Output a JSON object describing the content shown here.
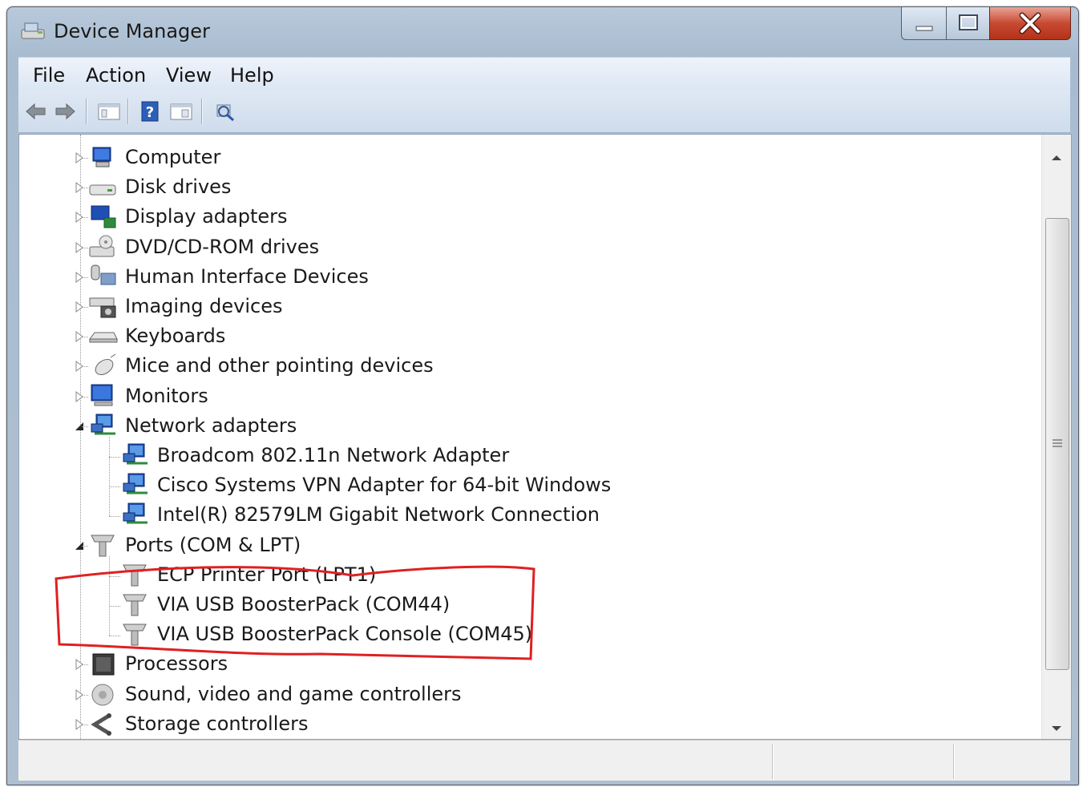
{
  "window": {
    "title": "Device Manager",
    "title_icon": "device-manager-icon",
    "controls": [
      "minimize-icon",
      "maximize-icon",
      "close-icon"
    ]
  },
  "menu": {
    "items": [
      "File",
      "Action",
      "View",
      "Help"
    ]
  },
  "toolbar": {
    "buttons": [
      "back-arrow-icon",
      "forward-arrow-icon",
      "show-hide-console-tree-icon",
      "help-icon",
      "properties-icon",
      "scan-hardware-icon"
    ]
  },
  "tree": {
    "items": [
      {
        "label": "Computer",
        "icon": "computer-icon",
        "level": 0,
        "state": "collapsed"
      },
      {
        "label": "Disk drives",
        "icon": "disk-drive-icon",
        "level": 0,
        "state": "collapsed"
      },
      {
        "label": "Display adapters",
        "icon": "display-adapter-icon",
        "level": 0,
        "state": "collapsed"
      },
      {
        "label": "DVD/CD-ROM drives",
        "icon": "dvd-drive-icon",
        "level": 0,
        "state": "collapsed"
      },
      {
        "label": "Human Interface Devices",
        "icon": "hid-icon",
        "level": 0,
        "state": "collapsed"
      },
      {
        "label": "Imaging devices",
        "icon": "imaging-device-icon",
        "level": 0,
        "state": "collapsed"
      },
      {
        "label": "Keyboards",
        "icon": "keyboard-icon",
        "level": 0,
        "state": "collapsed"
      },
      {
        "label": "Mice and other pointing devices",
        "icon": "mouse-icon",
        "level": 0,
        "state": "collapsed"
      },
      {
        "label": "Monitors",
        "icon": "monitor-icon",
        "level": 0,
        "state": "collapsed"
      },
      {
        "label": "Network adapters",
        "icon": "network-adapter-icon",
        "level": 0,
        "state": "expanded"
      },
      {
        "label": "Broadcom 802.11n Network Adapter",
        "icon": "network-adapter-icon",
        "level": 1
      },
      {
        "label": "Cisco Systems VPN Adapter for 64-bit Windows",
        "icon": "network-adapter-icon",
        "level": 1
      },
      {
        "label": "Intel(R) 82579LM Gigabit Network Connection",
        "icon": "network-adapter-icon",
        "level": 1
      },
      {
        "label": "Ports (COM & LPT)",
        "icon": "port-icon",
        "level": 0,
        "state": "expanded"
      },
      {
        "label": "ECP Printer Port (LPT1)",
        "icon": "port-icon",
        "level": 1
      },
      {
        "label": "VIA USB BoosterPack (COM44)",
        "icon": "port-icon",
        "level": 1
      },
      {
        "label": "VIA USB BoosterPack Console (COM45)",
        "icon": "port-icon",
        "level": 1
      },
      {
        "label": "Processors",
        "icon": "processor-icon",
        "level": 0,
        "state": "collapsed"
      },
      {
        "label": "Sound, video and game controllers",
        "icon": "sound-icon",
        "level": 0,
        "state": "collapsed"
      },
      {
        "label": "Storage controllers",
        "icon": "storage-controller-icon",
        "level": 0,
        "state": "collapsed"
      }
    ]
  },
  "annotation": {
    "color": "#e02020",
    "highlighted_items": [
      "VIA USB BoosterPack (COM44)",
      "VIA USB BoosterPack Console (COM45)"
    ]
  },
  "colors": {
    "title_bar": "#b9c9dc",
    "close_button": "#c84a33",
    "menu_bar": "#e4ecf7"
  }
}
